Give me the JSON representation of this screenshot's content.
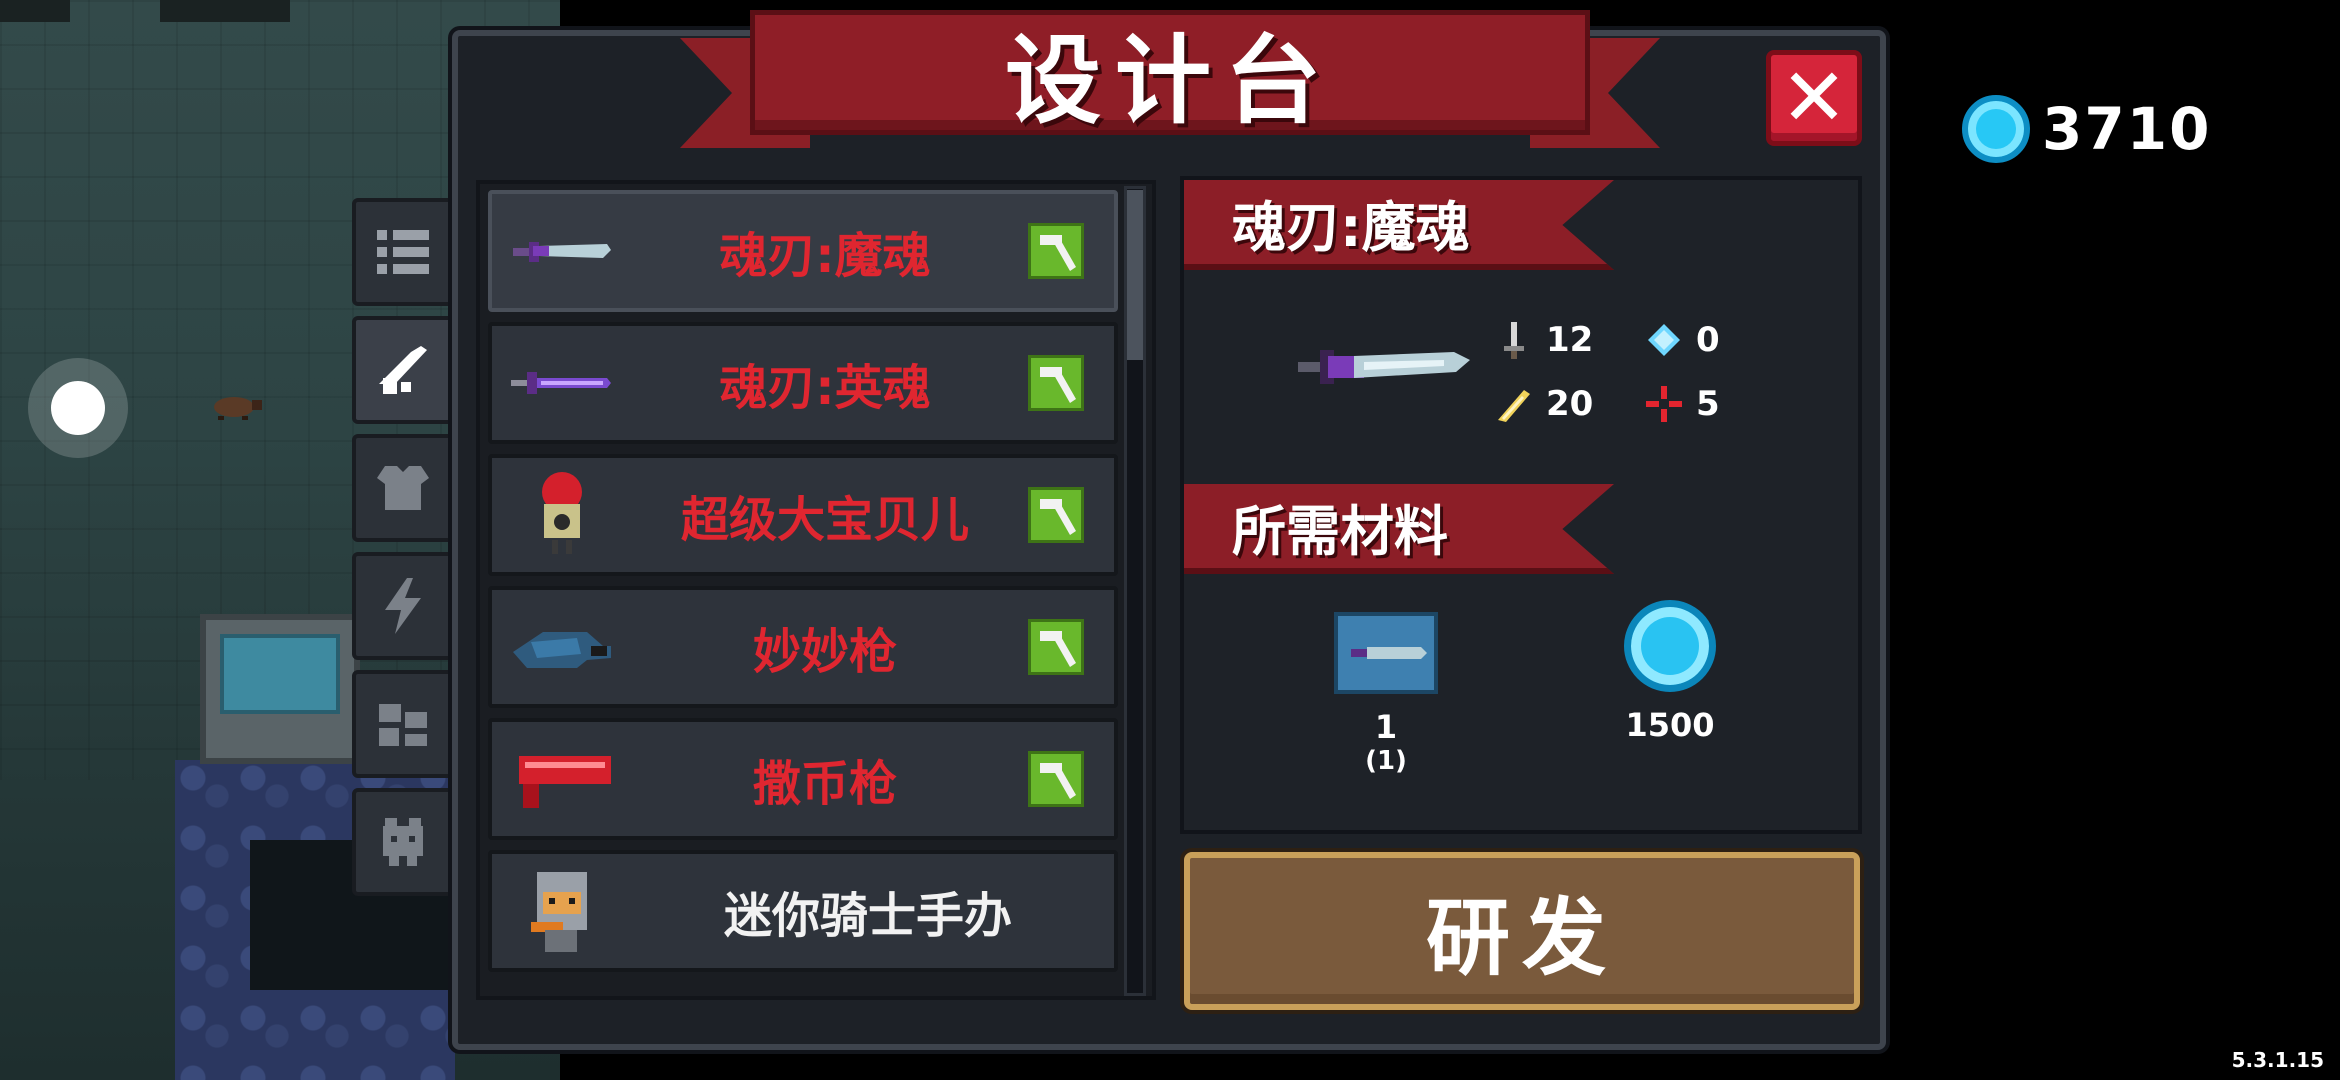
{
  "title": "设计台",
  "close_label": "✕",
  "gems": {
    "count": "3710",
    "icon": "gem-icon",
    "color": "#27c8f5"
  },
  "side_tabs": [
    {
      "icon": "list-icon"
    },
    {
      "icon": "weapon-icon"
    },
    {
      "icon": "armor-icon"
    },
    {
      "icon": "lightning-icon"
    },
    {
      "icon": "machine-icon"
    },
    {
      "icon": "pet-icon"
    }
  ],
  "recipes": [
    {
      "name": "魂刃:魔魂",
      "icon": "sword-icon",
      "craftable": true,
      "color": "#e02630"
    },
    {
      "name": "魂刃:英魂",
      "icon": "sword-icon",
      "craftable": true,
      "color": "#e02630"
    },
    {
      "name": "超级大宝贝儿",
      "icon": "robot-icon",
      "craftable": true,
      "color": "#e02630"
    },
    {
      "name": "妙妙枪",
      "icon": "gun-icon",
      "craftable": true,
      "color": "#e02630"
    },
    {
      "name": "撒币枪",
      "icon": "red-gun-icon",
      "craftable": true,
      "color": "#e02630"
    },
    {
      "name": "迷你骑士手办",
      "icon": "knight-figure-icon",
      "craftable": false,
      "color": "#f2f2f2"
    }
  ],
  "detail": {
    "name": "魂刃:魔魂",
    "stats": {
      "damage": "12",
      "energy": "0",
      "crit": "20",
      "precision": "5"
    },
    "materials_title": "所需材料",
    "materials": [
      {
        "icon": "blueprint-icon",
        "count": "1",
        "sub": "(1)"
      },
      {
        "icon": "gem-coin-icon",
        "count": "1500"
      }
    ]
  },
  "develop_label": "研发",
  "version": "5.3.1.15",
  "colors": {
    "banner_red": "#8f1e27",
    "craft_green": "#69b82c",
    "button_brown": "#7a5a3c",
    "close_red": "#d5253a"
  }
}
